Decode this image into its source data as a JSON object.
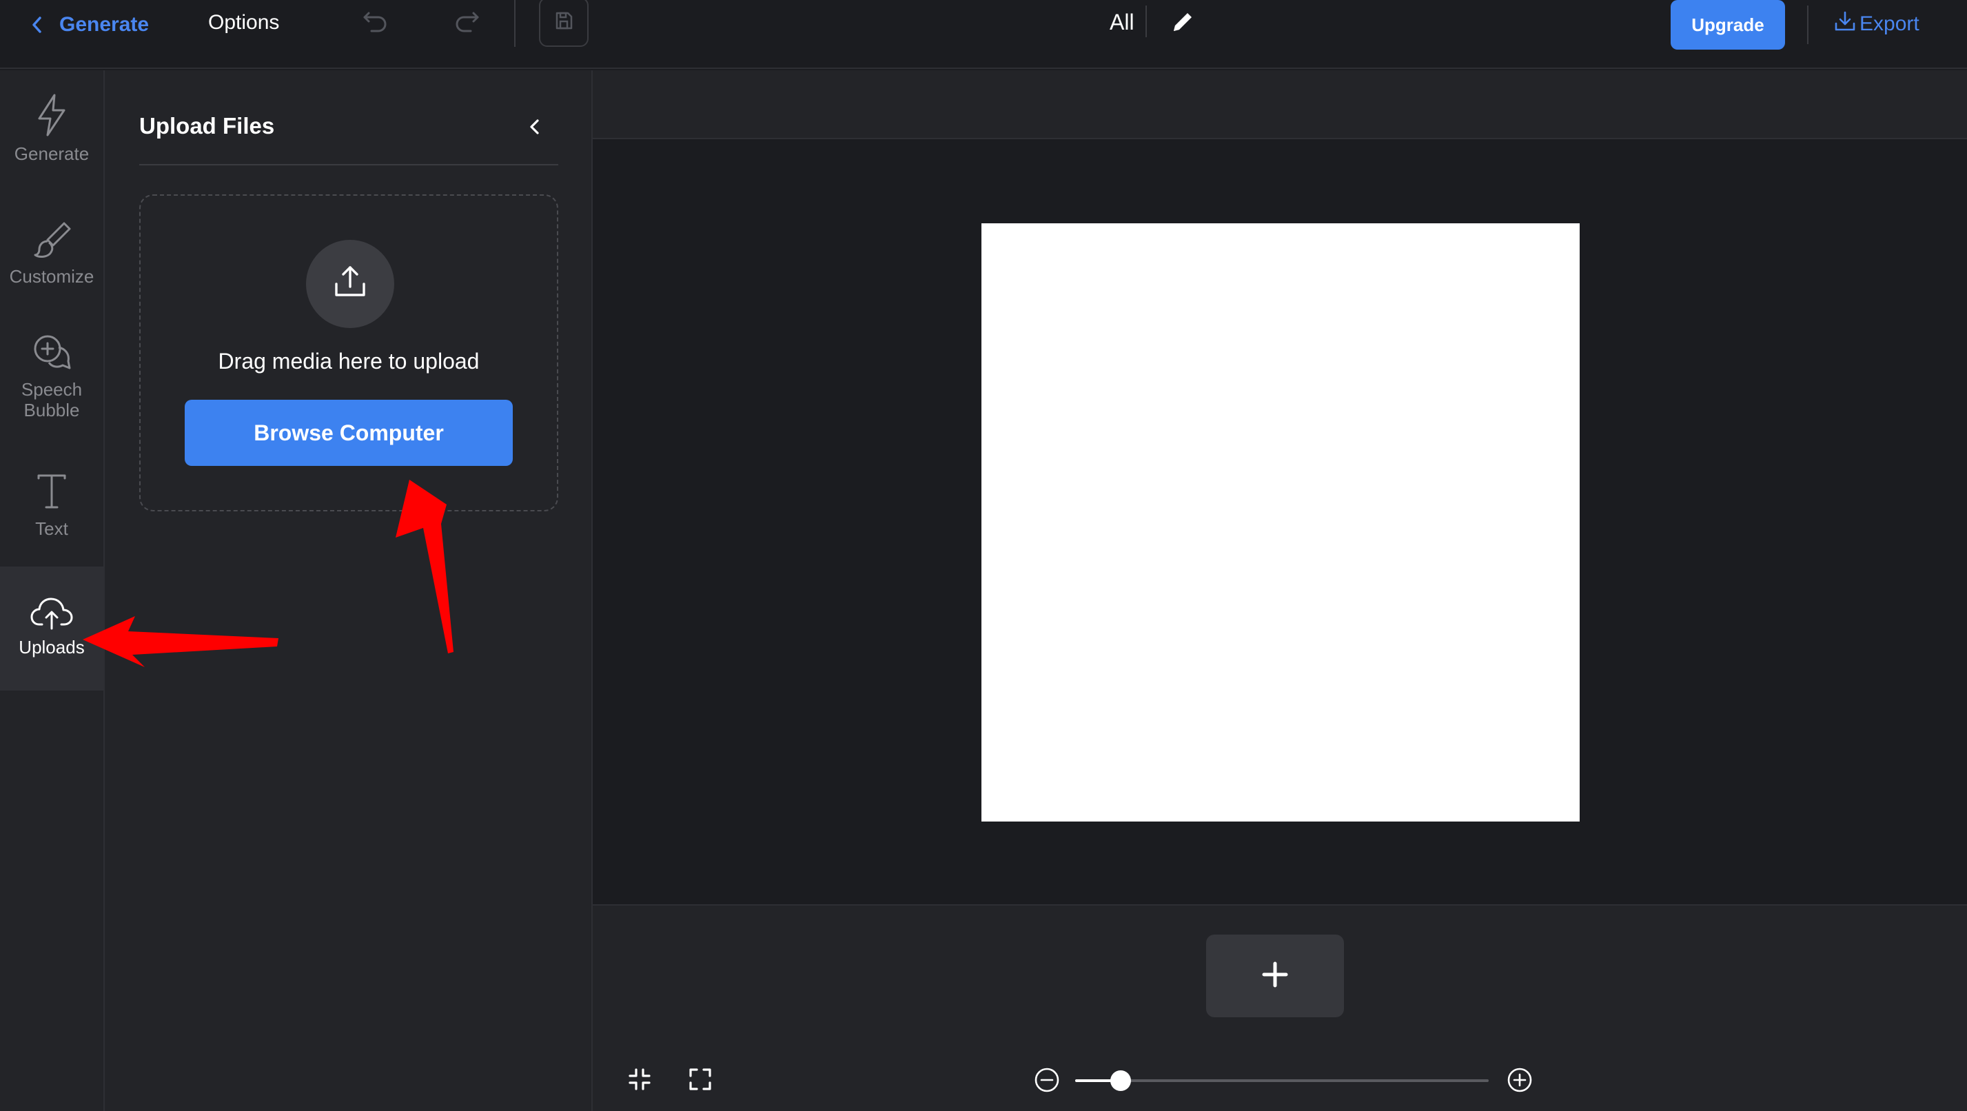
{
  "topbar": {
    "back_label": "Generate",
    "options_label": "Options",
    "all_label": "All",
    "upgrade_label": "Upgrade",
    "export_label": "Export"
  },
  "rail": {
    "items": [
      {
        "label": "Generate",
        "icon": "bolt-icon"
      },
      {
        "label": "Customize",
        "icon": "brush-icon"
      },
      {
        "label": "Speech Bubble",
        "icon": "speech-bubble-icon"
      },
      {
        "label": "Text",
        "icon": "text-icon"
      },
      {
        "label": "Uploads",
        "icon": "cloud-upload-icon",
        "active": true
      }
    ]
  },
  "panel": {
    "title": "Upload Files",
    "drag_text": "Drag media here to upload",
    "browse_label": "Browse Computer"
  },
  "zoom": {
    "level": 0.11
  },
  "colors": {
    "accent": "#3d82f0",
    "link": "#4a86f0",
    "background": "#1b1c20",
    "panel": "#232428",
    "annotation_arrow": "#ff0000"
  }
}
